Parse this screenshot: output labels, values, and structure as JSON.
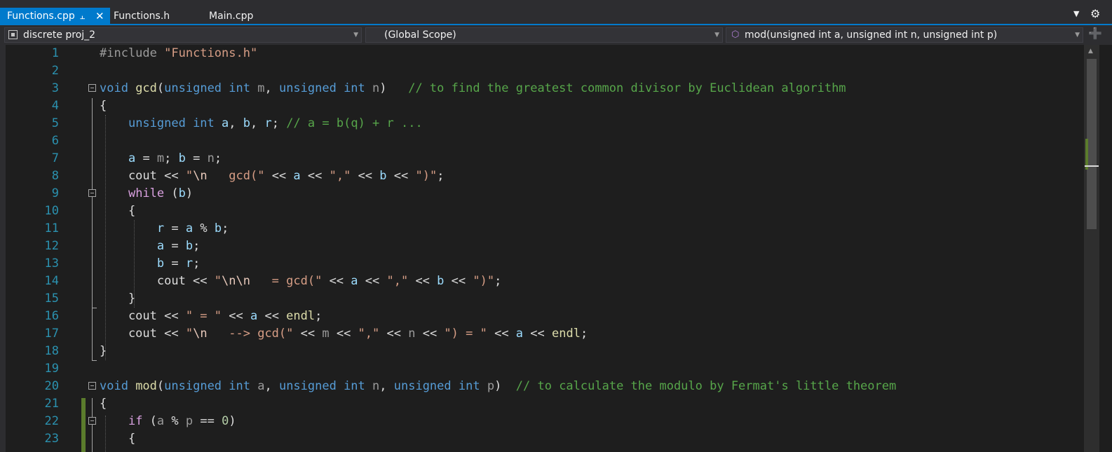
{
  "tabs": [
    {
      "label": "Functions.cpp",
      "active": true,
      "pin_icon": "pin-icon",
      "close_icon": "close-icon"
    },
    {
      "label": "Functions.h",
      "active": false
    },
    {
      "label": "Main.cpp",
      "active": false
    }
  ],
  "tab_icons": {
    "overflow": "chevron-down-icon",
    "settings": "gear-icon"
  },
  "navbar": {
    "project": "discrete proj_2",
    "scope": "(Global Scope)",
    "member": "mod(unsigned int a, unsigned int n, unsigned int p)",
    "split_icon": "split-editor-icon"
  },
  "colors": {
    "accent": "#007acc",
    "background": "#1e1e1e",
    "line_number": "#2b91af",
    "keyword": "#569cd6",
    "control_keyword": "#d8a0df",
    "function": "#dcdcaa",
    "string": "#d69d85",
    "comment": "#57a64a",
    "variable": "#9cdcfe",
    "change_marker": "#5b7c2c"
  },
  "editor": {
    "lines": [
      {
        "n": "1",
        "t": [
          [
            "pp",
            "#include "
          ],
          [
            "str",
            "\"Functions.h\""
          ]
        ]
      },
      {
        "n": "2",
        "t": []
      },
      {
        "n": "3",
        "t": [
          [
            "kw",
            "void "
          ],
          [
            "fn",
            "gcd"
          ],
          [
            "",
            "("
          ],
          [
            "kw",
            "unsigned int "
          ],
          [
            "prm",
            "m"
          ],
          [
            "",
            ", "
          ],
          [
            "kw",
            "unsigned int "
          ],
          [
            "prm",
            "n"
          ],
          [
            "",
            ")   "
          ],
          [
            "cm",
            "// to find the greatest common divisor by Euclidean algorithm"
          ]
        ]
      },
      {
        "n": "4",
        "t": [
          [
            "",
            "{"
          ]
        ]
      },
      {
        "n": "5",
        "t": [
          [
            "",
            "    "
          ],
          [
            "kw",
            "unsigned int "
          ],
          [
            "var",
            "a"
          ],
          [
            "",
            ", "
          ],
          [
            "var",
            "b"
          ],
          [
            "",
            ", "
          ],
          [
            "var",
            "r"
          ],
          [
            "",
            "; "
          ],
          [
            "cm",
            "// a = b(q) + r ..."
          ]
        ]
      },
      {
        "n": "6",
        "t": []
      },
      {
        "n": "7",
        "t": [
          [
            "",
            "    "
          ],
          [
            "var",
            "a"
          ],
          [
            "",
            " = "
          ],
          [
            "prm",
            "m"
          ],
          [
            "",
            "; "
          ],
          [
            "var",
            "b"
          ],
          [
            "",
            " = "
          ],
          [
            "prm",
            "n"
          ],
          [
            "",
            ";"
          ]
        ]
      },
      {
        "n": "8",
        "t": [
          [
            "",
            "    cout << "
          ],
          [
            "str",
            "\""
          ],
          [
            "esc",
            "\\n"
          ],
          [
            "str",
            "   gcd(\""
          ],
          [
            "",
            " << "
          ],
          [
            "var",
            "a"
          ],
          [
            "",
            " << "
          ],
          [
            "str",
            "\",\""
          ],
          [
            "",
            " << "
          ],
          [
            "var",
            "b"
          ],
          [
            "",
            " << "
          ],
          [
            "str",
            "\")\""
          ],
          [
            "",
            ";"
          ]
        ]
      },
      {
        "n": "9",
        "t": [
          [
            "",
            "    "
          ],
          [
            "ctl",
            "while"
          ],
          [
            "",
            " ("
          ],
          [
            "var",
            "b"
          ],
          [
            "",
            ")"
          ]
        ]
      },
      {
        "n": "10",
        "t": [
          [
            "",
            "    {"
          ]
        ]
      },
      {
        "n": "11",
        "t": [
          [
            "",
            "        "
          ],
          [
            "var",
            "r"
          ],
          [
            "",
            " = "
          ],
          [
            "var",
            "a"
          ],
          [
            "",
            " % "
          ],
          [
            "var",
            "b"
          ],
          [
            "",
            ";"
          ]
        ]
      },
      {
        "n": "12",
        "t": [
          [
            "",
            "        "
          ],
          [
            "var",
            "a"
          ],
          [
            "",
            " = "
          ],
          [
            "var",
            "b"
          ],
          [
            "",
            ";"
          ]
        ]
      },
      {
        "n": "13",
        "t": [
          [
            "",
            "        "
          ],
          [
            "var",
            "b"
          ],
          [
            "",
            " = "
          ],
          [
            "var",
            "r"
          ],
          [
            "",
            ";"
          ]
        ]
      },
      {
        "n": "14",
        "t": [
          [
            "",
            "        cout << "
          ],
          [
            "str",
            "\""
          ],
          [
            "esc",
            "\\n\\n"
          ],
          [
            "str",
            "   = gcd(\""
          ],
          [
            "",
            " << "
          ],
          [
            "var",
            "a"
          ],
          [
            "",
            " << "
          ],
          [
            "str",
            "\",\""
          ],
          [
            "",
            " << "
          ],
          [
            "var",
            "b"
          ],
          [
            "",
            " << "
          ],
          [
            "str",
            "\")\""
          ],
          [
            "",
            ";"
          ]
        ]
      },
      {
        "n": "15",
        "t": [
          [
            "",
            "    }"
          ]
        ]
      },
      {
        "n": "16",
        "t": [
          [
            "",
            "    cout << "
          ],
          [
            "str",
            "\" = \""
          ],
          [
            "",
            " << "
          ],
          [
            "var",
            "a"
          ],
          [
            "",
            " << "
          ],
          [
            "fn",
            "endl"
          ],
          [
            "",
            ";"
          ]
        ]
      },
      {
        "n": "17",
        "t": [
          [
            "",
            "    cout << "
          ],
          [
            "str",
            "\""
          ],
          [
            "esc",
            "\\n"
          ],
          [
            "str",
            "   --> gcd(\""
          ],
          [
            "",
            " << "
          ],
          [
            "prm",
            "m"
          ],
          [
            "",
            " << "
          ],
          [
            "str",
            "\",\""
          ],
          [
            "",
            " << "
          ],
          [
            "prm",
            "n"
          ],
          [
            "",
            " << "
          ],
          [
            "str",
            "\") = \""
          ],
          [
            "",
            " << "
          ],
          [
            "var",
            "a"
          ],
          [
            "",
            " << "
          ],
          [
            "fn",
            "endl"
          ],
          [
            "",
            ";"
          ]
        ]
      },
      {
        "n": "18",
        "t": [
          [
            "",
            "}"
          ]
        ]
      },
      {
        "n": "19",
        "t": []
      },
      {
        "n": "20",
        "t": [
          [
            "kw",
            "void "
          ],
          [
            "fn",
            "mod"
          ],
          [
            "",
            "("
          ],
          [
            "kw",
            "unsigned int "
          ],
          [
            "prm",
            "a"
          ],
          [
            "",
            ", "
          ],
          [
            "kw",
            "unsigned int "
          ],
          [
            "prm",
            "n"
          ],
          [
            "",
            ", "
          ],
          [
            "kw",
            "unsigned int "
          ],
          [
            "prm",
            "p"
          ],
          [
            "",
            ")  "
          ],
          [
            "cm",
            "// to calculate the modulo by Fermat's little theorem"
          ]
        ]
      },
      {
        "n": "21",
        "t": [
          [
            "",
            "{"
          ]
        ]
      },
      {
        "n": "22",
        "t": [
          [
            "",
            "    "
          ],
          [
            "ctl",
            "if"
          ],
          [
            "",
            " ("
          ],
          [
            "prm",
            "a"
          ],
          [
            "",
            " % "
          ],
          [
            "prm",
            "p"
          ],
          [
            "",
            " == "
          ],
          [
            "num",
            "0"
          ],
          [
            "",
            ")"
          ]
        ]
      },
      {
        "n": "23",
        "t": [
          [
            "",
            "    {"
          ]
        ]
      }
    ]
  }
}
